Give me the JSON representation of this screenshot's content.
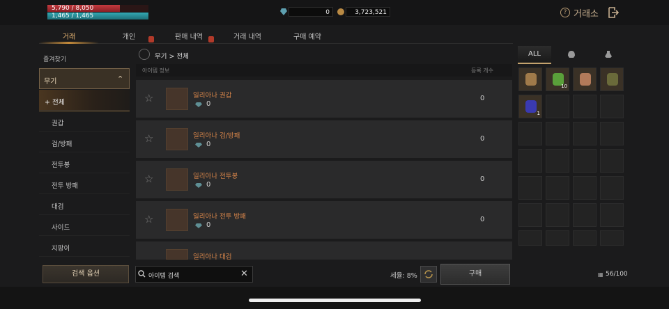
{
  "status": {
    "hp_text": "5,790 / 8,050",
    "hp_fraction": 0.72,
    "mp_text": "1,465 / 1,465",
    "mp_fraction": 1.0,
    "diamonds": "0",
    "gold": "3,723,521"
  },
  "header": {
    "help_glyph": "?",
    "title": "거래소"
  },
  "tabs": [
    {
      "label": "거래"
    },
    {
      "label": "개인"
    },
    {
      "label": "판매 내역"
    },
    {
      "label": "거래 내역"
    },
    {
      "label": "구매 예약"
    }
  ],
  "sidebar": {
    "favorites": "즐겨찾기",
    "category": "무기",
    "items": [
      {
        "label": "+ 전체"
      },
      {
        "label": "권갑"
      },
      {
        "label": "검/방패"
      },
      {
        "label": "전투봉"
      },
      {
        "label": "전투 방패"
      },
      {
        "label": "대검"
      },
      {
        "label": "사이드"
      },
      {
        "label": "지팡이"
      }
    ]
  },
  "list": {
    "breadcrumb": "무기 > 전체",
    "col_item": "아이템 정보",
    "col_count": "등록 개수",
    "rows": [
      {
        "name": "일리아나 권갑",
        "price": "0",
        "count": "0"
      },
      {
        "name": "일리아나 검/방패",
        "price": "0",
        "count": "0"
      },
      {
        "name": "일리아나 전투봉",
        "price": "0",
        "count": "0"
      },
      {
        "name": "일리아나 전투 방패",
        "price": "0",
        "count": "0"
      },
      {
        "name": "일리아나 대검",
        "price": "",
        "count": ""
      }
    ]
  },
  "bottom": {
    "search_options": "검색 옵션",
    "search_placeholder": "아이템 검색",
    "tax": "세율: 8%",
    "buy": "구매",
    "inventory": "56/100"
  },
  "inventory": {
    "tabs": [
      {
        "label": "ALL"
      },
      {
        "label": ""
      },
      {
        "label": ""
      }
    ],
    "slots": [
      {
        "icon": "amulet-icon",
        "badge": ""
      },
      {
        "icon": "potion-icon",
        "badge": "10"
      },
      {
        "icon": "ring-icon",
        "badge": ""
      },
      {
        "icon": "boots-icon",
        "badge": ""
      },
      {
        "icon": "gem-icon",
        "badge": "1"
      }
    ]
  },
  "colors": {
    "accent": "#c48a3a",
    "item_name": "#d9864a",
    "hp": "#c33a3f",
    "mp": "#34a8b3"
  }
}
